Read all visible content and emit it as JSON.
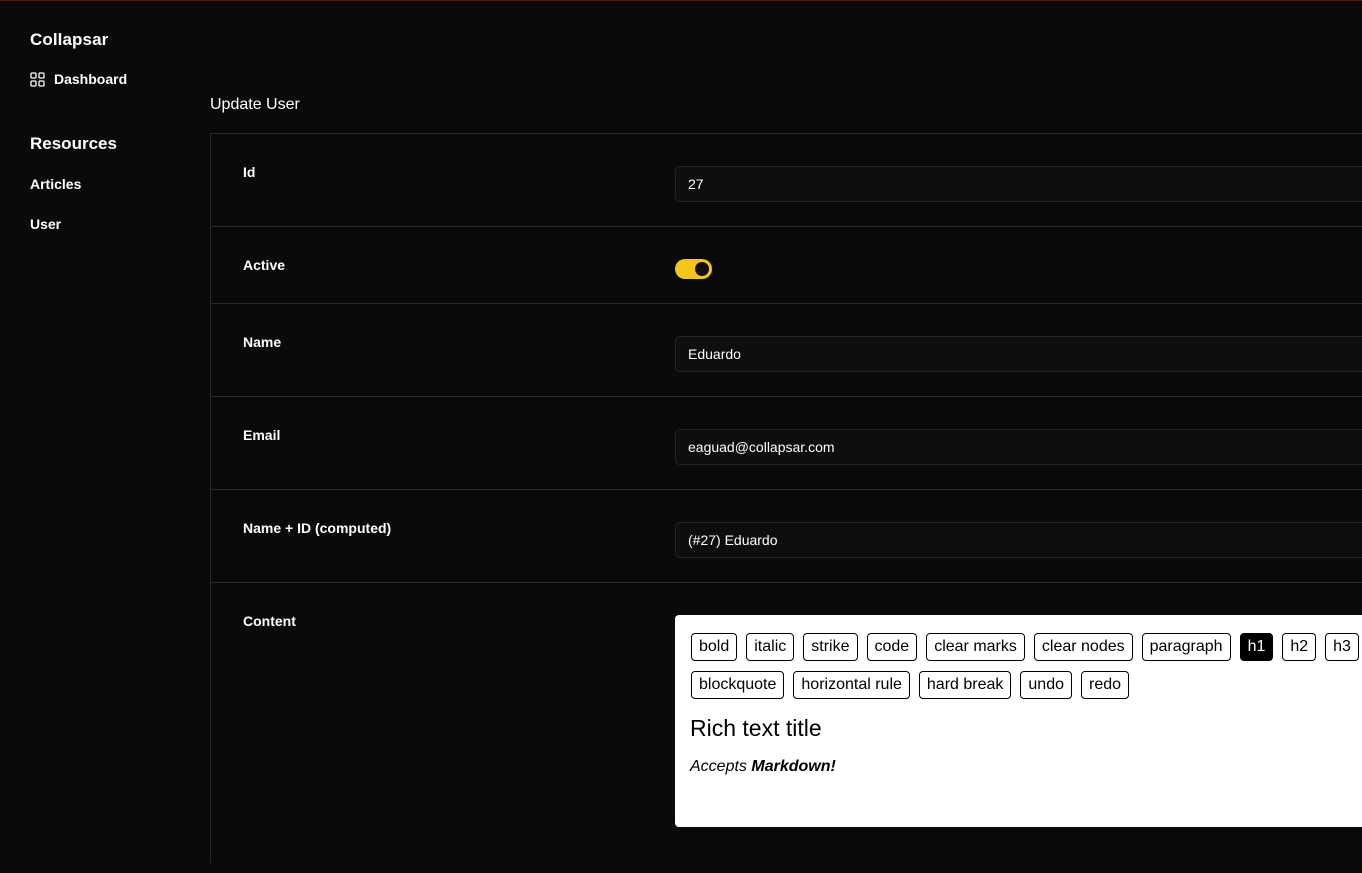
{
  "sidebar": {
    "brand": "Collapsar",
    "dashboard": {
      "label": "Dashboard",
      "icon": "grid-icon"
    },
    "resources_title": "Resources",
    "items": [
      {
        "label": "Articles"
      },
      {
        "label": "User"
      }
    ]
  },
  "main": {
    "title": "Update User",
    "fields": {
      "id": {
        "label": "Id",
        "value": "27"
      },
      "active": {
        "label": "Active",
        "value": true
      },
      "name": {
        "label": "Name",
        "value": "Eduardo"
      },
      "email": {
        "label": "Email",
        "value": "eaguad@collapsar.com"
      },
      "computed": {
        "label": "Name + ID (computed)",
        "value": "(#27) Eduardo"
      },
      "content": {
        "label": "Content"
      }
    }
  },
  "editor": {
    "toolbar_row1": [
      "bold",
      "italic",
      "strike",
      "code",
      "clear marks",
      "clear nodes",
      "paragraph",
      "h1",
      "h2",
      "h3"
    ],
    "toolbar_row2": [
      "blockquote",
      "horizontal rule",
      "hard break",
      "undo",
      "redo"
    ],
    "active_button": "h1",
    "heading": "Rich text title",
    "para_prefix": "Accepts ",
    "para_bold": "Markdown!"
  },
  "colors": {
    "background": "#0b0a0a",
    "accent": "#f5c518",
    "border": "#2a2a2a"
  }
}
